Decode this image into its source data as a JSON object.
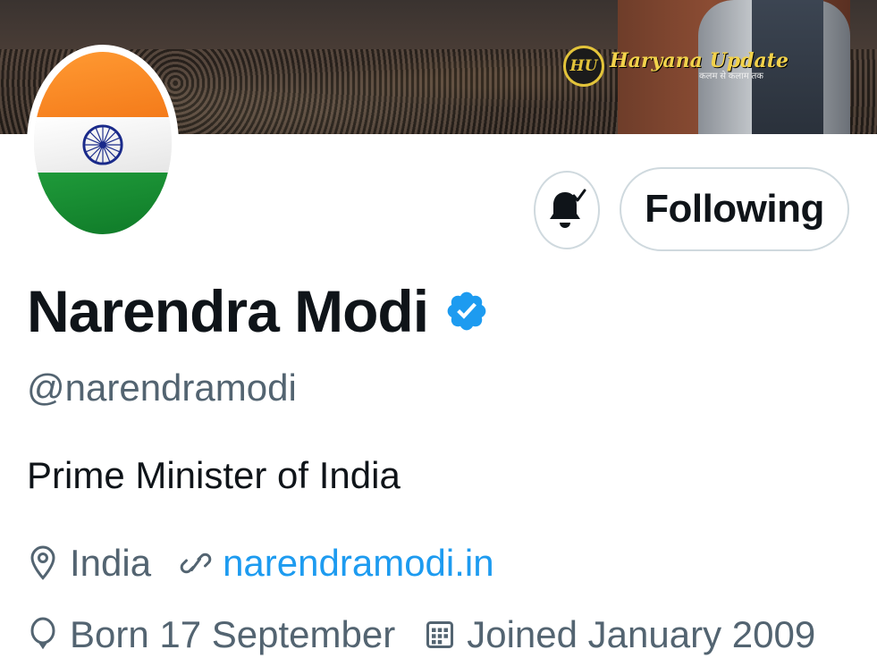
{
  "banner": {
    "watermark_logo": "HU",
    "watermark_title": "Haryana Update",
    "watermark_subtitle": "कलम से कलाम तक"
  },
  "profile": {
    "avatar_icon": "indian-flag",
    "name": "Narendra Modi",
    "verified_icon": "verified-badge-icon",
    "handle": "@narendramodi",
    "bio": "Prime Minister of India",
    "location": "India",
    "website": "narendramodi.in",
    "birthday": "Born 17 September",
    "joined": "Joined January 2009"
  },
  "actions": {
    "notifications_icon": "bell-check-icon",
    "follow_label": "Following"
  },
  "colors": {
    "accent": "#1d9bf0",
    "text_primary": "#0f1419",
    "text_secondary": "#536471",
    "border": "#cfd9de"
  }
}
